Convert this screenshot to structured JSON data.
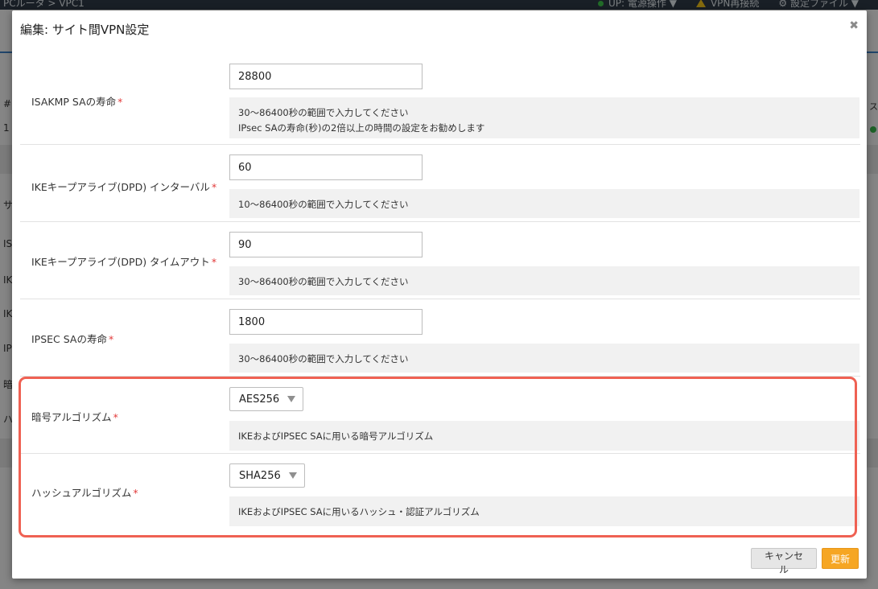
{
  "background": {
    "breadcrumb": "PCルータ > VPC1",
    "status_text": "UP: 電源操作 ▼",
    "vpn_reconnect": "VPN再接続",
    "config_file": "設定ファイル ▼",
    "left_fragments": [
      "#",
      "1",
      "サ",
      "IS",
      "IK",
      "IK",
      "IP",
      "暗",
      "ハ"
    ],
    "right_header": "ス"
  },
  "modal": {
    "title": "編集: サイト間VPN設定",
    "close_icon": "✖",
    "fields": [
      {
        "label": "ISAKMP SAの寿命",
        "required_mark": "*",
        "value": "28800",
        "help_lines": [
          "30〜86400秒の範囲で入力してください",
          "IPsec SAの寿命(秒)の2倍以上の時間の設定をお勧めします"
        ]
      },
      {
        "label": "IKEキープアライブ(DPD) インターバル",
        "required_mark": "*",
        "value": "60",
        "help_lines": [
          "10〜86400秒の範囲で入力してください"
        ]
      },
      {
        "label": "IKEキープアライブ(DPD) タイムアウト",
        "required_mark": "*",
        "value": "90",
        "help_lines": [
          "30〜86400秒の範囲で入力してください"
        ]
      },
      {
        "label": "IPSEC SAの寿命",
        "required_mark": "*",
        "value": "1800",
        "help_lines": [
          "30〜86400秒の範囲で入力してください"
        ]
      },
      {
        "label": "暗号アルゴリズム",
        "required_mark": "*",
        "selected": "AES256",
        "help_lines": [
          "IKEおよびIPSEC SAに用いる暗号アルゴリズム"
        ]
      },
      {
        "label": "ハッシュアルゴリズム",
        "required_mark": "*",
        "selected": "SHA256",
        "help_lines": [
          "IKEおよびIPSEC SAに用いるハッシュ・認証アルゴリズム"
        ]
      }
    ],
    "buttons": {
      "cancel": "キャンセル",
      "update": "更新"
    }
  },
  "colors": {
    "accent_orange": "#f6a623",
    "highlight_red": "#ef6153",
    "required_red": "#e23a3a"
  }
}
